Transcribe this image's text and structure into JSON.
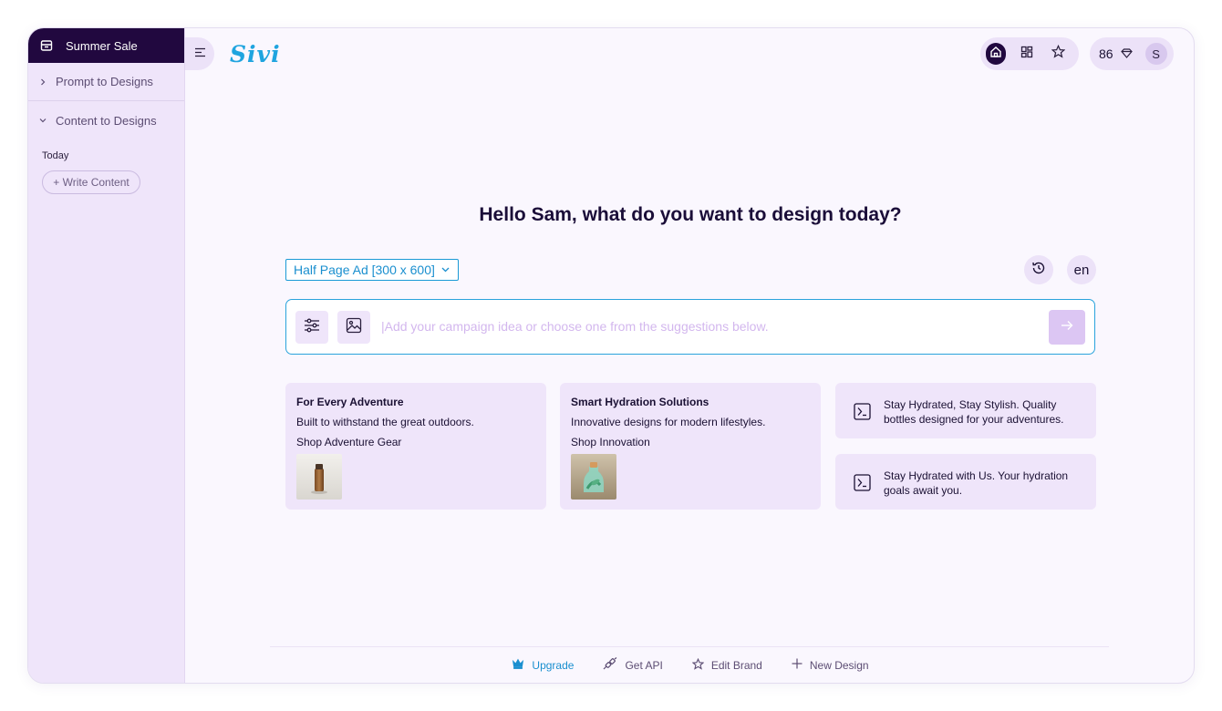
{
  "sidebar": {
    "title": "Summer Sale",
    "items": [
      {
        "label": "Prompt to Designs",
        "expanded": false
      },
      {
        "label": "Content to Designs",
        "expanded": true
      }
    ],
    "section_label": "Today",
    "write_content": "+ Write Content"
  },
  "header": {
    "logo": "Sivi",
    "credits": "86",
    "avatar_initial": "S"
  },
  "main": {
    "greeting": "Hello Sam, what do you want to design today?",
    "size_select": "Half Page Ad [300 x 600]",
    "language": "en",
    "prompt_placeholder": "|Add your campaign idea or choose one from the suggestions below.",
    "cards": [
      {
        "title": "For Every Adventure",
        "subtitle": "Built to withstand the great outdoors.",
        "cta": "Shop Adventure Gear"
      },
      {
        "title": "Smart Hydration Solutions",
        "subtitle": "Innovative designs for modern lifestyles.",
        "cta": "Shop Innovation"
      }
    ],
    "suggestions": [
      "Stay Hydrated, Stay Stylish. Quality bottles designed for your adventures.",
      "Stay Hydrated with Us. Your hydration goals await you."
    ]
  },
  "footer": {
    "links": [
      "Upgrade",
      "Get API",
      "Edit Brand",
      "New Design"
    ]
  },
  "colors": {
    "accent": "#1a9ad6",
    "sidebar_dark": "#21083f",
    "panel": "#efe5fa"
  }
}
